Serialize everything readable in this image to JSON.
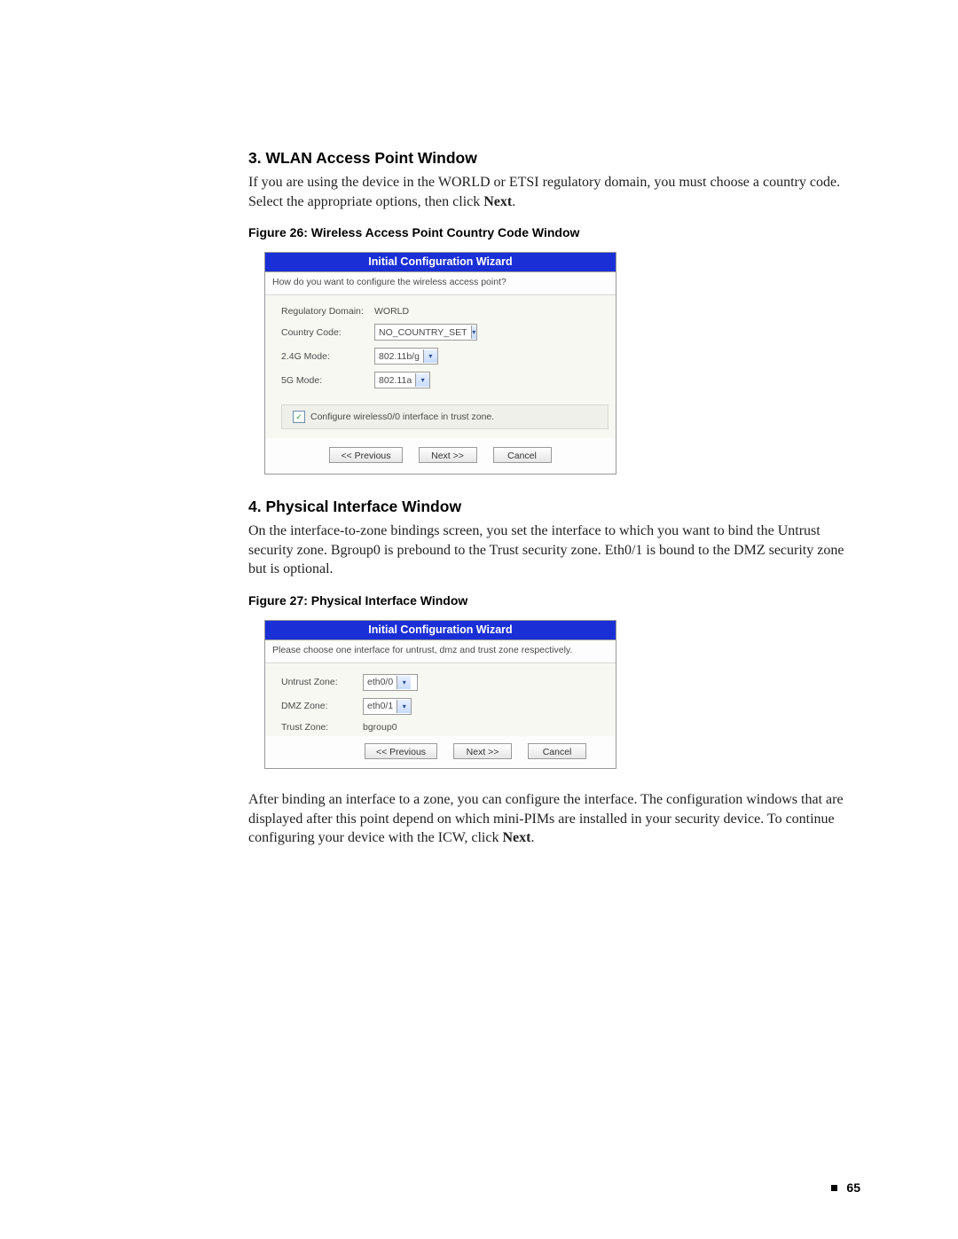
{
  "section3": {
    "heading": "3. WLAN Access Point Window",
    "para_a": "If you are using the device in the WORLD or ETSI regulatory domain, you must choose a country code. Select the appropriate options, then click ",
    "para_b": "Next",
    "para_c": "."
  },
  "fig26": {
    "caption": "Figure 26:  Wireless Access Point Country Code Window",
    "title": "Initial Configuration Wizard",
    "prompt": "How do you want to configure the wireless access point?",
    "rows": {
      "reg_label": "Regulatory Domain:",
      "reg_value": "WORLD",
      "cc_label": "Country Code:",
      "cc_value": "NO_COUNTRY_SET",
      "g24_label": "2.4G Mode:",
      "g24_value": "802.11b/g",
      "g5_label": "5G Mode:",
      "g5_value": "802.11a"
    },
    "checkbox_label": "Configure wireless0/0 interface in trust zone.",
    "buttons": {
      "prev": "<< Previous",
      "next": "Next >>",
      "cancel": "Cancel"
    }
  },
  "section4": {
    "heading": "4. Physical Interface Window",
    "para": "On the interface-to-zone bindings screen, you set the interface to which you want to bind the Untrust security zone. Bgroup0 is prebound to the Trust security zone. Eth0/1 is bound to the DMZ security zone but is optional."
  },
  "fig27": {
    "caption": "Figure 27:  Physical Interface Window",
    "title": "Initial Configuration Wizard",
    "prompt": "Please choose one interface for untrust, dmz and trust zone respectively.",
    "rows": {
      "untrust_label": "Untrust Zone:",
      "untrust_value": "eth0/0",
      "dmz_label": "DMZ Zone:",
      "dmz_value": "eth0/1",
      "trust_label": "Trust Zone:",
      "trust_value": "bgroup0"
    },
    "buttons": {
      "prev": "<< Previous",
      "next": "Next >>",
      "cancel": "Cancel"
    }
  },
  "after": {
    "para_a": "After binding an interface to a zone, you can configure the interface. The configuration windows that are displayed after this point depend on which mini-PIMs are installed in your security device. To continue configuring your device with the ICW, click ",
    "para_b": "Next",
    "para_c": "."
  },
  "page_number": "65"
}
